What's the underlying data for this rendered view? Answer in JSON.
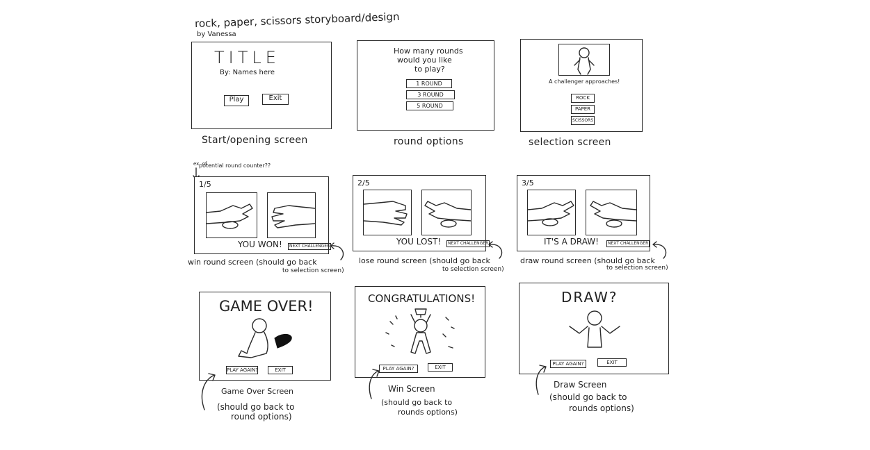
{
  "header": {
    "title": "rock, paper, scissors storyboard/design",
    "byline": "by Vanessa"
  },
  "panels": {
    "start": {
      "title": "TITLE",
      "names": "By: Names here",
      "play": "Play",
      "exit": "Exit",
      "caption": "Start/opening screen"
    },
    "rounds": {
      "question_l1": "How many rounds",
      "question_l2": "would you like",
      "question_l3": "to play?",
      "opt1": "1 ROUND",
      "opt2": "3 ROUND",
      "opt3": "5 ROUND",
      "caption": "round options"
    },
    "selection": {
      "prompt": "A challenger approaches!",
      "rock": "ROCK",
      "paper": "PAPER",
      "scissors": "SCISSORS",
      "caption": "selection screen"
    },
    "win_round": {
      "note_l1": "ex. of",
      "note_l2": "potential round counter??",
      "counter": "1/5",
      "result": "YOU WON!",
      "next": "NEXT CHALLENGER",
      "caption": "win round screen (should go back",
      "caption2": "to selection screen)"
    },
    "lose_round": {
      "counter": "2/5",
      "result": "YOU LOST!",
      "next": "NEXT CHALLENGER",
      "caption": "lose round screen (should go back",
      "caption2": "to selection screen)"
    },
    "draw_round": {
      "counter": "3/5",
      "result": "IT'S A DRAW!",
      "next": "NEXT CHALLENGER",
      "caption": "draw round screen (should go back",
      "caption2": "to selection screen)"
    },
    "game_over": {
      "title": "GAME OVER!",
      "play_again": "PLAY AGAIN?",
      "exit": "EXIT",
      "caption": "Game Over Screen",
      "note_l1": "(should go back to",
      "note_l2": "round options)"
    },
    "win": {
      "title": "CONGRATULATIONS!",
      "play_again": "PLAY AGAIN?",
      "exit": "EXIT",
      "caption": "Win Screen",
      "note_l1": "(should go back to",
      "note_l2": "rounds options)"
    },
    "draw": {
      "title": "DRAW?",
      "play_again": "PLAY AGAIN?",
      "exit": "EXIT",
      "caption": "Draw Screen",
      "note_l1": "(should go back to",
      "note_l2": "rounds options)"
    }
  }
}
